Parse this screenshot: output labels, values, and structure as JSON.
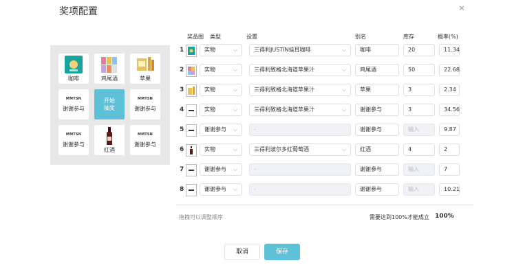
{
  "dialog": {
    "title": "奖项配置",
    "close_icon": "×"
  },
  "grid": {
    "cells": [
      {
        "label": "咖啡",
        "thumb": "coffee"
      },
      {
        "label": "鸡尾酒",
        "thumb": "cocktail"
      },
      {
        "label": "苹果",
        "thumb": "apple"
      },
      {
        "label": "谢谢参与",
        "logo": "MMTSN"
      },
      {
        "label": "开始\n抽奖",
        "center": true
      },
      {
        "label": "谢谢参与",
        "logo": "MMTSN"
      },
      {
        "label": "谢谢参与",
        "logo": "MMTSN"
      },
      {
        "label": "红酒",
        "thumb": "wine"
      },
      {
        "label": "谢谢参与",
        "logo": "MMTSN"
      }
    ],
    "start_line1": "开始",
    "start_line2": "抽奖"
  },
  "table": {
    "headers": {
      "image": "奖品图",
      "type": "类型",
      "setting": "设置",
      "alias": "别名",
      "stock": "库存",
      "prob": "概率(%)"
    },
    "rows": [
      {
        "index": "1",
        "thumb": "coffee",
        "type": "实物",
        "setting": "三得利JUSTIN挂耳咖啡",
        "alias": "咖啡",
        "stock": "20",
        "prob": "11.34"
      },
      {
        "index": "2",
        "thumb": "cocktail",
        "type": "实物",
        "setting": "三得利致格北海道苹果汁",
        "alias": "鸡尾酒",
        "stock": "50",
        "prob": "22.68"
      },
      {
        "index": "3",
        "thumb": "apple",
        "type": "实物",
        "setting": "三得利致格北海道苹果汁",
        "alias": "苹果",
        "stock": "3",
        "prob": "2.34"
      },
      {
        "index": "4",
        "thumb": "logo",
        "type": "实物",
        "setting": "三得利致格北海道苹果汁",
        "alias": "谢谢参与",
        "stock": "3",
        "prob": "34.56"
      },
      {
        "index": "5",
        "thumb": "logo",
        "type": "谢谢参与",
        "setting": "-",
        "alias": "谢谢参与",
        "stock": "",
        "stock_placeholder": "输入",
        "prob": "9.87"
      },
      {
        "index": "6",
        "thumb": "wine",
        "type": "实物",
        "setting": "三得利波尔多红葡萄酒",
        "alias": "红酒",
        "stock": "4",
        "prob": "2"
      },
      {
        "index": "7",
        "thumb": "logo",
        "type": "谢谢参与",
        "setting": "-",
        "alias": "谢谢参与",
        "stock": "",
        "stock_placeholder": "输入",
        "prob": "7"
      },
      {
        "index": "8",
        "thumb": "logo",
        "type": "谢谢参与",
        "setting": "-",
        "alias": "谢谢参与",
        "stock": "",
        "stock_placeholder": "输入",
        "prob": "10.21"
      }
    ]
  },
  "footer": {
    "hint": "拖拽可以调整顺序",
    "need": "需要达到100%才能成立",
    "total": "100%",
    "cancel_label": "取消",
    "save_label": "保存"
  },
  "colors": {
    "accent": "#5fc1d8",
    "panel_bg": "#e8e8e8",
    "coffee": "#1aa39a",
    "wine": "#5a1a1a",
    "apple": "#d9a441"
  }
}
